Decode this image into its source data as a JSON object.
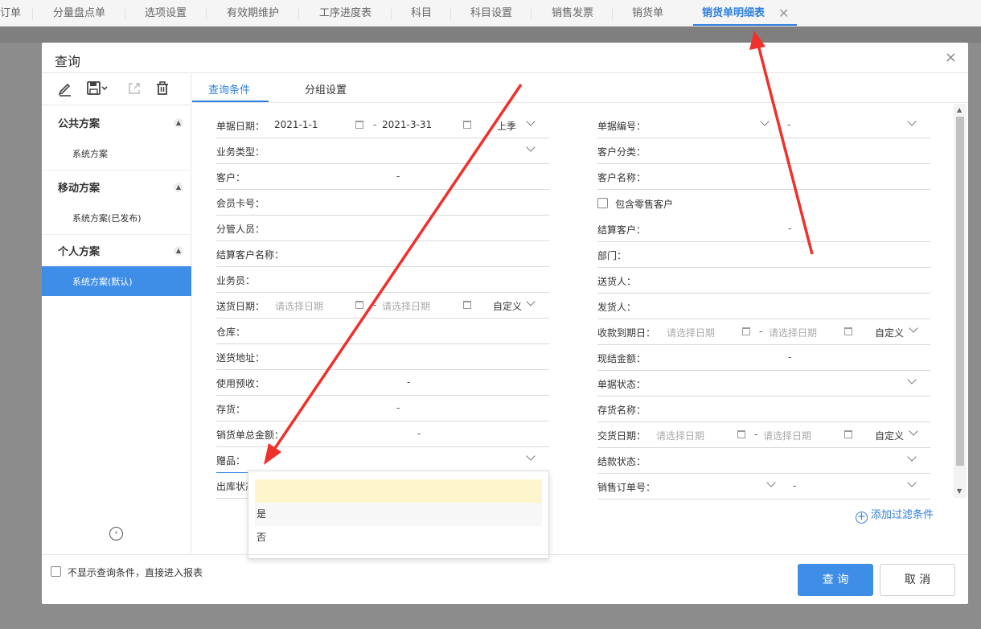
{
  "top_tabs": [
    "订单",
    "分量盘点单",
    "选项设置",
    "有效期维护",
    "工序进度表",
    "科目",
    "科目设置",
    "销售发票",
    "销货单",
    "销货单明细表"
  ],
  "dialog": {
    "title": "查询",
    "close": "×",
    "groups": [
      {
        "title": "公共方案",
        "item": "系统方案"
      },
      {
        "title": "移动方案",
        "item": "系统方案(已发布)"
      },
      {
        "title": "个人方案",
        "item": "系统方案(默认)"
      }
    ],
    "tabs": [
      "查询条件",
      "分组设置"
    ],
    "left_fields": {
      "doc_date": {
        "label": "单据日期：",
        "from": "2021-1-1",
        "to": "2021-3-31",
        "preset": "上季"
      },
      "biz_type": "业务类型：",
      "customer": "客户：",
      "member_card": "会员卡号：",
      "manager": "分管人员：",
      "settle_name": "结算客户名称：",
      "salesman": "业务员：",
      "ship_date": {
        "label": "送货日期：",
        "from_ph": "请选择日期",
        "to_ph": "请选择日期",
        "preset": "自定义"
      },
      "warehouse": "仓库：",
      "address": "送货地址：",
      "prepay": "使用预收：",
      "stock": "存货：",
      "total": "销货单总金额：",
      "gift": "赠品：",
      "out_status": "出库状态："
    },
    "right_fields": {
      "doc_no": "单据编号：",
      "cust_cat": "客户分类：",
      "cust_name": "客户名称：",
      "retail": "包含零售客户",
      "settle_cust": "结算客户：",
      "dept": "部门：",
      "deliverer": "送货人：",
      "shipper": "发货人：",
      "due_date": {
        "label": "收款到期日：",
        "from_ph": "请选择日期",
        "to_ph": "请选择日期",
        "preset": "自定义"
      },
      "cash": "现结金额：",
      "doc_status": "单据状态：",
      "stock_name": "存货名称：",
      "deal_date": {
        "label": "交货日期：",
        "from_ph": "请选择日期",
        "to_ph": "请选择日期",
        "preset": "自定义"
      },
      "pay_status": "结款状态：",
      "so_no": "销售订单号："
    },
    "dash": "-",
    "add_filter": "添加过滤条件",
    "gift_options": [
      "",
      "是",
      "否"
    ],
    "skip_check": "不显示查询条件，直接进入报表",
    "query_btn": "查 询",
    "cancel_btn": "取 消"
  },
  "colors": {
    "accent": "#3e8ee8",
    "arrow": "#f0302a"
  }
}
